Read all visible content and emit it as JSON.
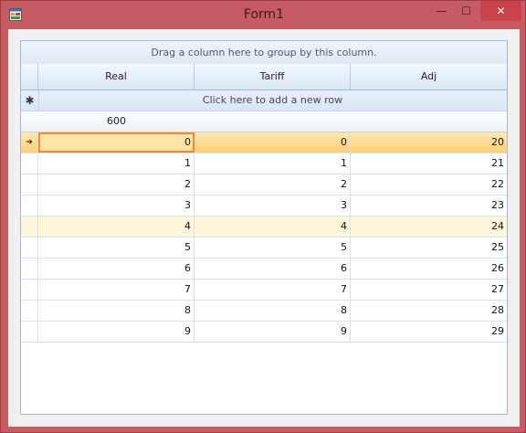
{
  "window": {
    "title": "Form1"
  },
  "caption_buttons": {
    "minimize": "—",
    "maximize": "☐",
    "close": "✕"
  },
  "grid": {
    "group_panel_text": "Drag a column here to group by this column.",
    "columns": [
      "Real",
      "Tariff",
      "Adj"
    ],
    "new_row_indicator": "✱",
    "new_row_text": "Click here to add a new row",
    "summary": {
      "real": "600"
    },
    "current_row_indicator": "➔",
    "rows": [
      {
        "real": "0",
        "tariff": "0",
        "adj": "20"
      },
      {
        "real": "1",
        "tariff": "1",
        "adj": "21"
      },
      {
        "real": "2",
        "tariff": "2",
        "adj": "22"
      },
      {
        "real": "3",
        "tariff": "3",
        "adj": "23"
      },
      {
        "real": "4",
        "tariff": "4",
        "adj": "24"
      },
      {
        "real": "5",
        "tariff": "5",
        "adj": "25"
      },
      {
        "real": "6",
        "tariff": "6",
        "adj": "26"
      },
      {
        "real": "7",
        "tariff": "7",
        "adj": "27"
      },
      {
        "real": "8",
        "tariff": "8",
        "adj": "28"
      },
      {
        "real": "9",
        "tariff": "9",
        "adj": "29"
      }
    ]
  },
  "colors": {
    "frame": "#c75b62",
    "close_button": "#c9414a",
    "current_row": "#ffcf74",
    "focus_border": "#f08a2a",
    "hover_row": "#fff6d9"
  }
}
